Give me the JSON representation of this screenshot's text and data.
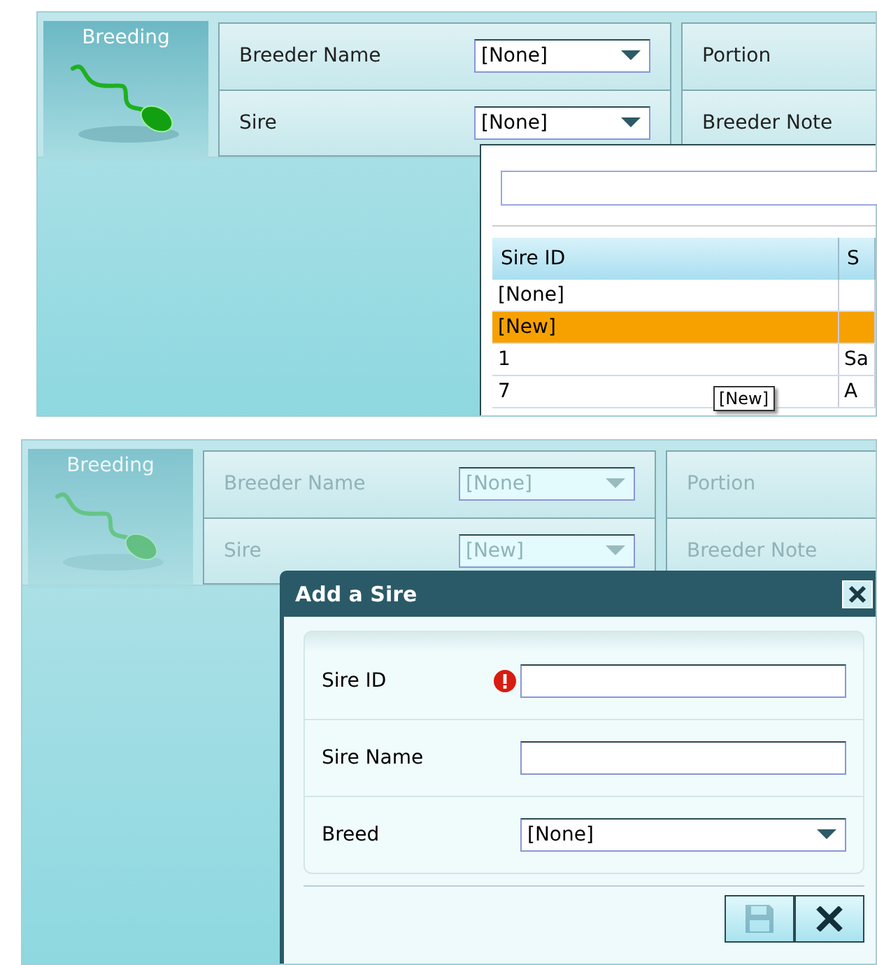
{
  "screens": [
    {
      "disabled": false,
      "section": {
        "label": "Breeding",
        "selected": true
      },
      "fields": [
        {
          "label": "Breeder Name",
          "value": "[None]"
        },
        {
          "label": "Sire",
          "value": "[None]"
        }
      ],
      "right_fields": [
        {
          "label": "Portion"
        },
        {
          "label": "Breeder Note"
        }
      ],
      "popup": {
        "kind": "dropdown",
        "columns": [
          "Sire ID",
          "S"
        ],
        "rows": [
          {
            "cells": [
              "[None]"
            ],
            "selected": false
          },
          {
            "cells": [
              "[New]"
            ],
            "selected": true
          },
          {
            "cells": [
              "1",
              "Sa"
            ],
            "selected": false
          },
          {
            "cells": [
              "7",
              "A"
            ],
            "selected": false
          }
        ],
        "tooltip": "[New]"
      }
    },
    {
      "disabled": true,
      "section": {
        "label": "Breeding",
        "selected": true
      },
      "fields": [
        {
          "label": "Breeder Name",
          "value": "[None]"
        },
        {
          "label": "Sire",
          "value": "[New]"
        }
      ],
      "right_fields": [
        {
          "label": "Portion"
        },
        {
          "label": "Breeder Note"
        }
      ],
      "popup": {
        "kind": "dialog",
        "title": "Add a Sire",
        "fields": [
          {
            "kind": "text",
            "label": "Sire ID",
            "required": true
          },
          {
            "kind": "text",
            "label": "Sire Name",
            "required": false
          },
          {
            "kind": "select",
            "label": "Breed",
            "value": "[None]",
            "required": false
          }
        ],
        "buttons": [
          {
            "kind": "save",
            "disabled": true
          },
          {
            "kind": "cancel",
            "disabled": false
          }
        ]
      }
    }
  ]
}
